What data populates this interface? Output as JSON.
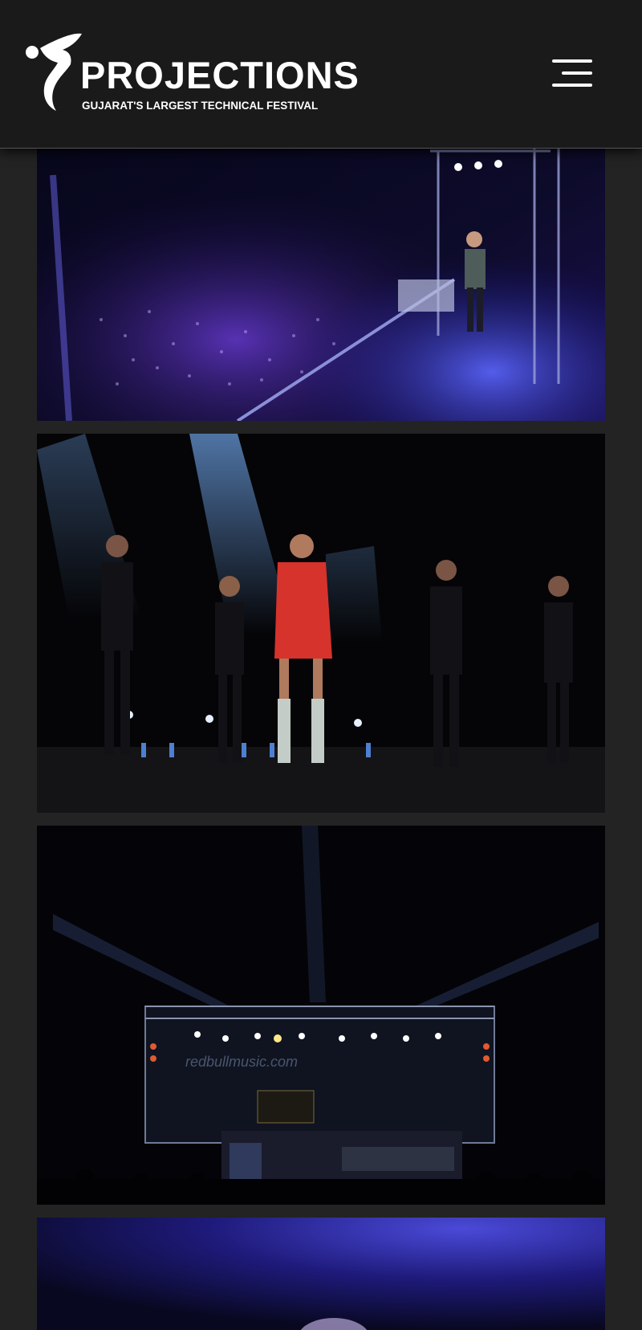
{
  "header": {
    "brand_name": "PROJECTIONS",
    "tagline": "GUJARAT'S LARGEST TECHNICAL FESTIVAL",
    "logo_icon": "dancer-logo-icon",
    "menu_icon": "hamburger-menu-icon"
  },
  "gallery": {
    "images": [
      {
        "subject": "DJ performing on stage above crowd"
      },
      {
        "subject": "Singer in red with dancers on stage"
      },
      {
        "subject": "Concert stage with lights",
        "banner_text": "redbullmusic.com"
      },
      {
        "subject": "Performer under blue light"
      }
    ]
  },
  "colors": {
    "page_bg": "#232323",
    "header_bg": "#1a1a1a",
    "accent_purple": "#5a2dcc",
    "accent_blue": "#2a3fd8",
    "stage_red": "#d6332c"
  }
}
